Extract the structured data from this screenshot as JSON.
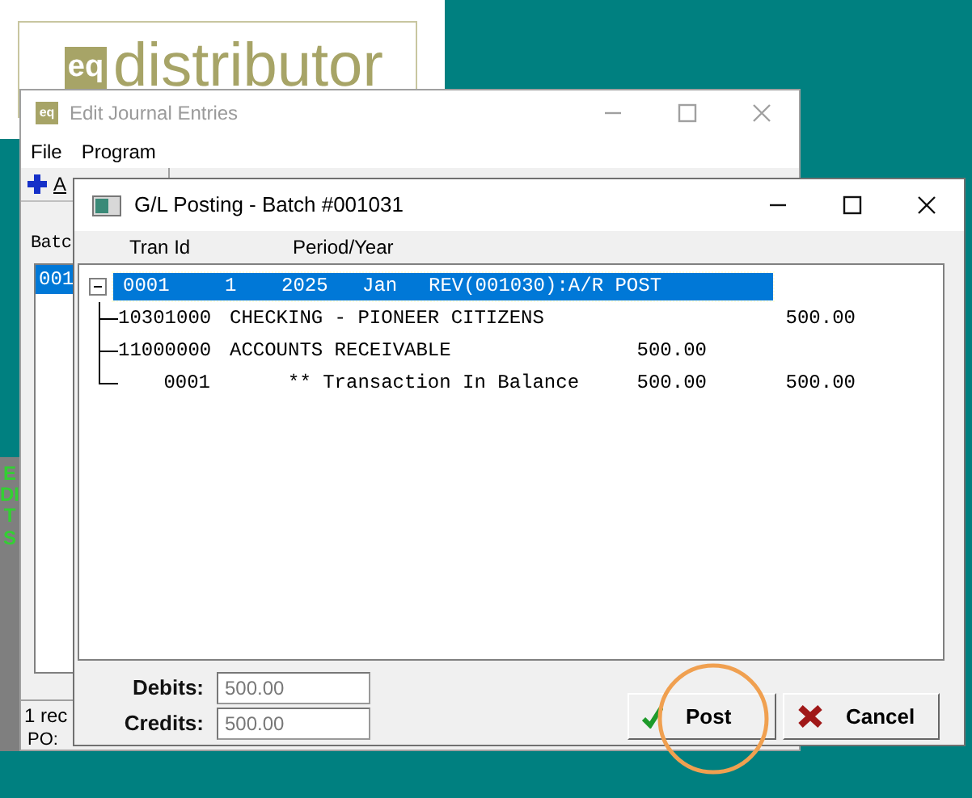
{
  "logo": {
    "mark": "eq",
    "text": "distributor"
  },
  "back_window": {
    "title": "Edit Journal Entries",
    "icon_text": "eq",
    "menu": [
      "File",
      "Program"
    ],
    "toolbar_button": "A",
    "list_label": "Batc",
    "list_items": [
      {
        "text": "001",
        "selected": true
      }
    ],
    "status": "1 rec",
    "status_2": "PO:"
  },
  "side_label": "EDITS",
  "dialog": {
    "title": "G/L Posting - Batch #001031",
    "columns": [
      "Tran Id",
      "Period/Year"
    ],
    "tree": [
      {
        "cells": [
          "0001",
          "1",
          "2025",
          "Jan",
          "REV(001030):A/R POST"
        ],
        "expanded": true,
        "selected": true,
        "children": [
          {
            "kind": "entry",
            "account": "10301000",
            "description": "CHECKING - PIONEER CITIZENS",
            "credit": "500.00"
          },
          {
            "kind": "entry",
            "account": "11000000",
            "description": "ACCOUNTS RECEIVABLE",
            "debit": "500.00"
          },
          {
            "kind": "total",
            "account": "0001",
            "description": "** Transaction In Balance",
            "debit": "500.00",
            "credit": "500.00"
          }
        ]
      }
    ],
    "totals": [
      {
        "label": "Debits:",
        "value": "500.00"
      },
      {
        "label": "Credits:",
        "value": "500.00"
      }
    ],
    "buttons": [
      {
        "label": "Post",
        "kind": "post"
      },
      {
        "label": "Cancel",
        "kind": "cancel"
      }
    ]
  }
}
